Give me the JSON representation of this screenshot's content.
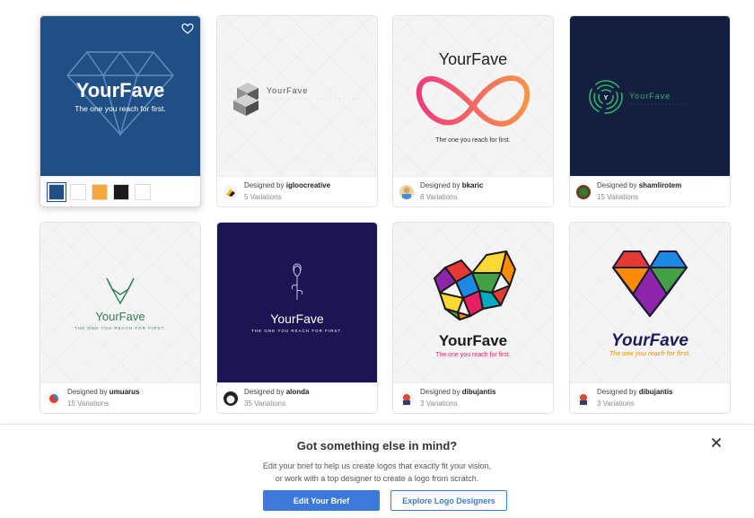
{
  "colors": {
    "accent": "#3d79d9",
    "selected_thumb_bg": "#1f4f85",
    "navy": "#141f3f",
    "indigo": "#1b1554"
  },
  "cards": [
    {
      "brand": "YourFave",
      "tagline": "The one you reach for first.",
      "swatch_colors": [
        "#1f4f85",
        "#ffffff",
        "#f3a73c",
        "#1a1a1a",
        "#ffffff"
      ]
    },
    {
      "brand": "YourFave",
      "designer_prefix": "Designed by",
      "designer": "igloocreative",
      "variations": "5 Variations"
    },
    {
      "brand": "YourFave",
      "tagline": "The one you reach for first.",
      "designer_prefix": "Designed by",
      "designer": "bkaric",
      "variations": "8 Variations"
    },
    {
      "brand": "YourFave",
      "designer_prefix": "Designed by",
      "designer": "shamlirotem",
      "variations": "15 Variations"
    },
    {
      "brand": "YourFave",
      "tagline": "THE ONE YOU REACH FOR FIRST.",
      "designer_prefix": "Designed by",
      "designer": "umuarus",
      "variations": "15 Variations"
    },
    {
      "brand": "YourFave",
      "tagline": "THE ONE YOU REACH FOR FIRST.",
      "designer_prefix": "Designed by",
      "designer": "alonda",
      "variations": "35 Variations"
    },
    {
      "brand": "YourFave",
      "tagline": "The one you reach for first.",
      "designer_prefix": "Designed by",
      "designer": "dibujantis",
      "variations": "3 Variations"
    },
    {
      "brand": "YourFave",
      "tagline": "The one you reach for first.",
      "designer_prefix": "Designed by",
      "designer": "dibujantis",
      "variations": "3 Variations"
    }
  ],
  "prompt": {
    "title": "Got something else in mind?",
    "line1": "Edit your brief to help us create logos that exactly fit your vision,",
    "line2": "or work with a top designer to create a logo from scratch.",
    "edit_button": "Edit Your Brief",
    "explore_button": "Explore Logo Designers"
  },
  "icons": {
    "favorite": "heart-outline-icon",
    "close": "close-icon"
  }
}
